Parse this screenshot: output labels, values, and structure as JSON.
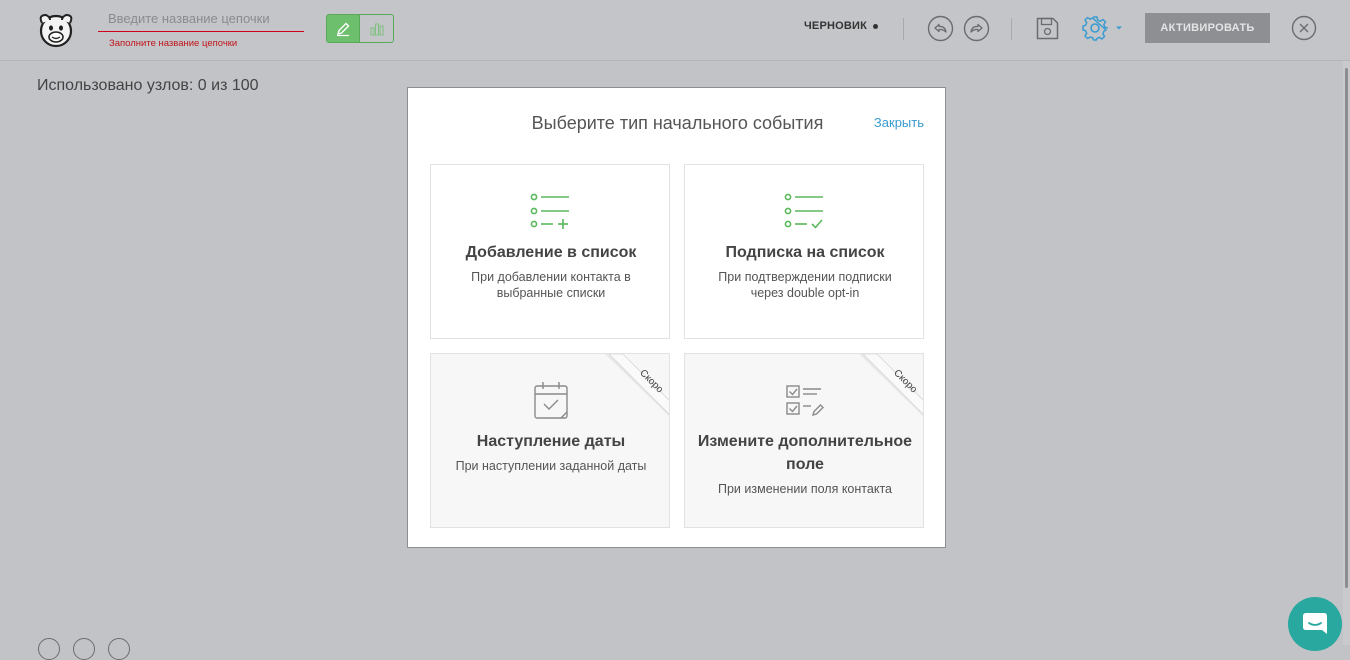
{
  "header": {
    "name_placeholder": "Введите название цепочки",
    "name_value": "",
    "name_error": "Заполните название цепочки",
    "status_label": "ЧЕРНОВИК",
    "activate_label": "АКТИВИРОВАТЬ"
  },
  "canvas": {
    "nodes_used": "Использовано узлов: 0 из 100"
  },
  "modal": {
    "title": "Выберите тип начального события",
    "close_label": "Закрыть",
    "cards": [
      {
        "title": "Добавление в список",
        "description": "При добавлении контакта в выбранные списки",
        "icon": "list-add-icon"
      },
      {
        "title": "Подписка на список",
        "description": "При подтверждении подписки через double opt-in",
        "icon": "list-check-icon"
      },
      {
        "title": "Наступление даты",
        "description": "При наступлении заданной даты",
        "icon": "calendar-check-icon",
        "badge": "Скоро"
      },
      {
        "title": "Измените дополнительное поле",
        "description": "При изменении поля контакта",
        "icon": "checklist-edit-icon",
        "badge": "Скоро"
      }
    ]
  },
  "colors": {
    "accent_green": "#6dbf6d",
    "link_blue": "#3a9bd0",
    "error_red": "#c0151b",
    "chat_teal": "#29a8a0"
  }
}
